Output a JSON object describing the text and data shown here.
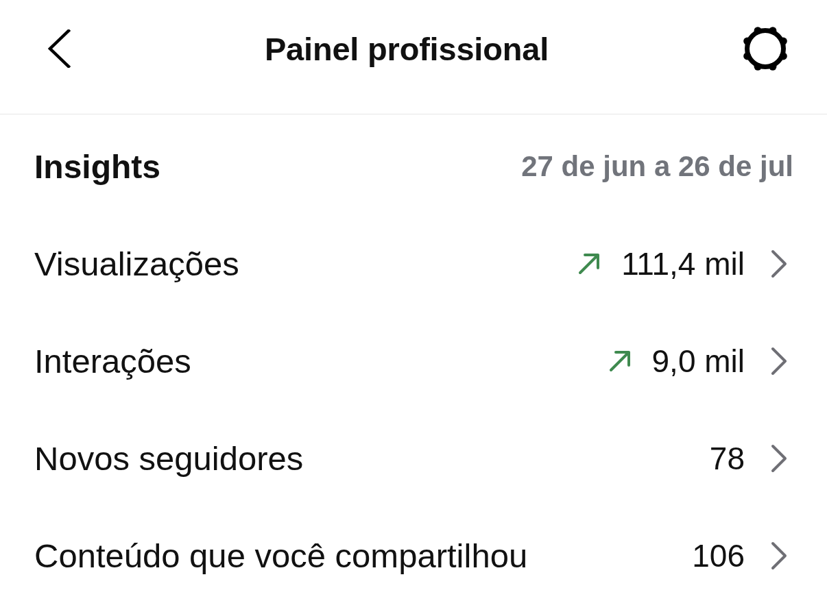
{
  "header": {
    "title": "Painel profissional"
  },
  "insights": {
    "title": "Insights",
    "date_range": "27 de jun a 26 de jul"
  },
  "metrics": [
    {
      "label": "Visualizações",
      "trending_up": true,
      "value": "111,4 mil"
    },
    {
      "label": "Interações",
      "trending_up": true,
      "value": "9,0 mil"
    },
    {
      "label": "Novos seguidores",
      "trending_up": false,
      "value": "78"
    },
    {
      "label": "Conteúdo que você compartilhou",
      "trending_up": false,
      "value": "106"
    }
  ]
}
